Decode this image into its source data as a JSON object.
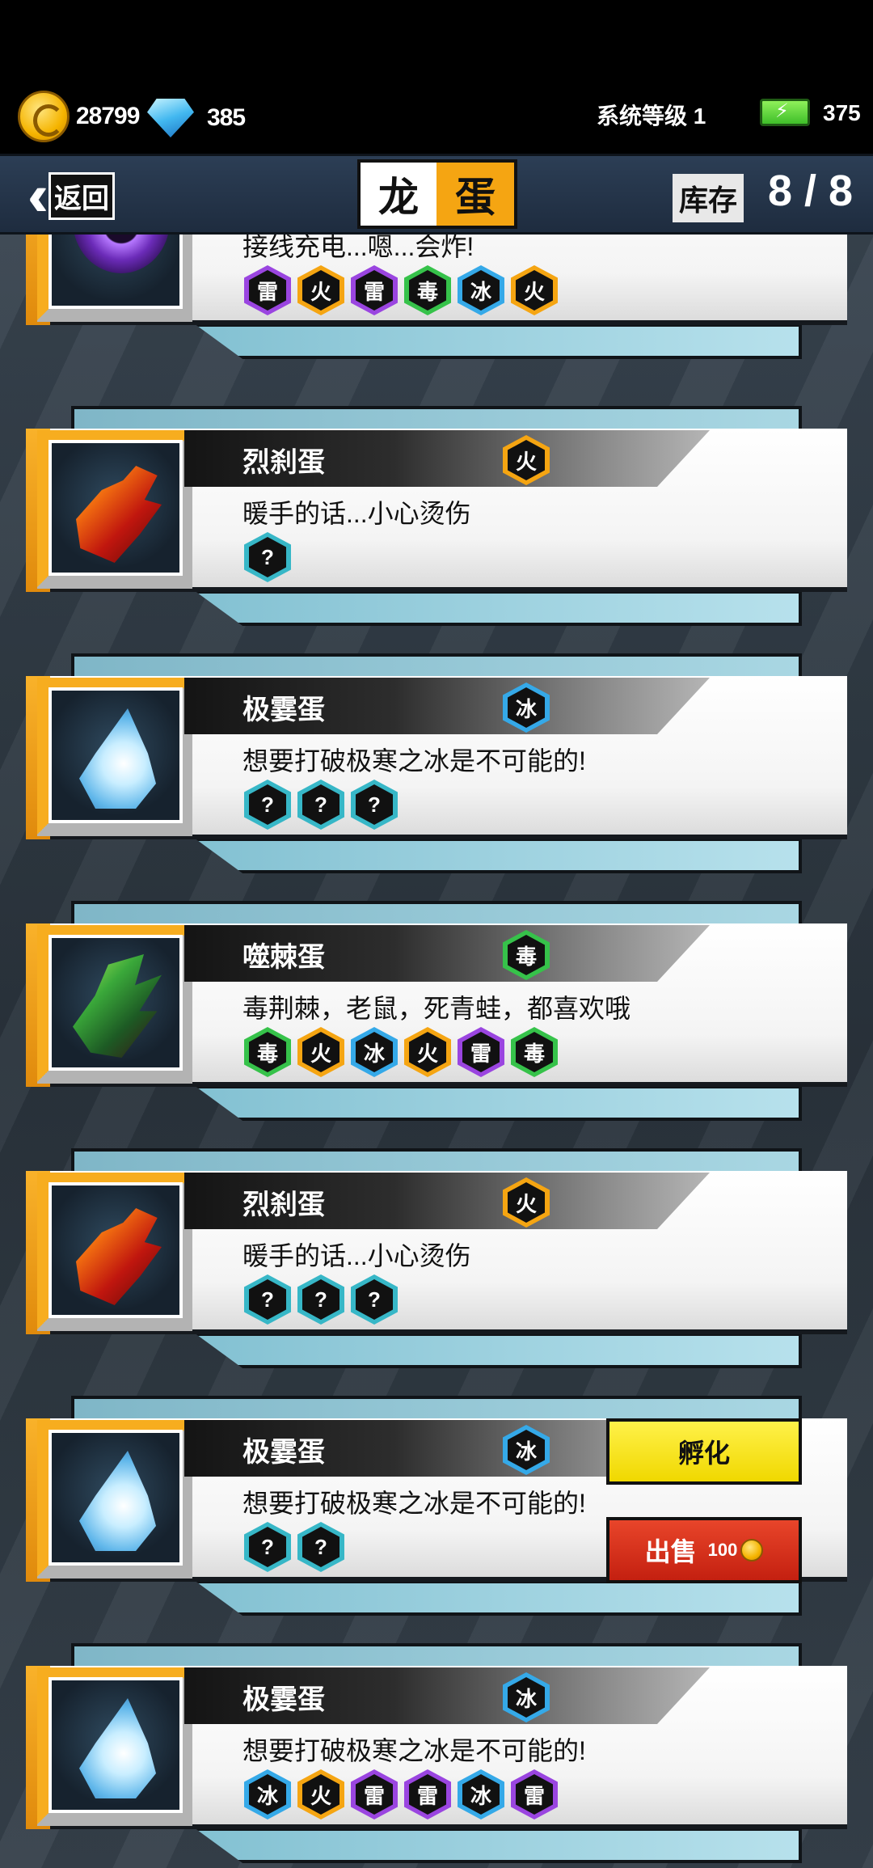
{
  "status": {
    "coins": "28799",
    "gems": "385",
    "system_level": "系统等级 1",
    "energy": "375"
  },
  "header": {
    "back_label": "返回",
    "title_left": "龙",
    "title_right": "蛋",
    "stock_label": "库存",
    "stock_value": "8 / 8"
  },
  "eggs": [
    {
      "name": "",
      "desc": "接线充电...嗯...会炸!",
      "type": "",
      "art": "thunder-egg",
      "tags": [
        "雷",
        "火",
        "雷",
        "毒",
        "冰",
        "火"
      ]
    },
    {
      "name": "烈刹蛋",
      "desc": "暖手的话...小心烫伤",
      "type": "火",
      "art": "fire-egg",
      "tags": [
        "?"
      ]
    },
    {
      "name": "极霎蛋",
      "desc": "想要打破极寒之冰是不可能的!",
      "type": "冰",
      "art": "ice-egg",
      "tags": [
        "?",
        "?",
        "?"
      ]
    },
    {
      "name": "噬棘蛋",
      "desc": "毒荆棘，老鼠，死青蛙，都喜欢哦",
      "type": "毒",
      "art": "poison-egg",
      "tags": [
        "毒",
        "火",
        "冰",
        "火",
        "雷",
        "毒"
      ]
    },
    {
      "name": "烈刹蛋",
      "desc": "暖手的话...小心烫伤",
      "type": "火",
      "art": "fire-egg",
      "tags": [
        "?",
        "?",
        "?"
      ]
    },
    {
      "name": "极霎蛋",
      "desc": "想要打破极寒之冰是不可能的!",
      "type": "冰",
      "art": "ice-egg",
      "tags": [
        "?",
        "?"
      ]
    },
    {
      "name": "极霎蛋",
      "desc": "想要打破极寒之冰是不可能的!",
      "type": "冰",
      "art": "ice-egg",
      "tags": [
        "冰",
        "火",
        "雷",
        "雷",
        "冰",
        "雷"
      ]
    }
  ],
  "actions": {
    "hatch_label": "孵化",
    "sell_label": "出售",
    "sell_price": "100"
  },
  "colors": {
    "fire": "#f5a512",
    "ice": "#35a9e8",
    "thunder": "#9a45e0",
    "poison": "#36c24a",
    "unknown": "#37b7c7"
  }
}
